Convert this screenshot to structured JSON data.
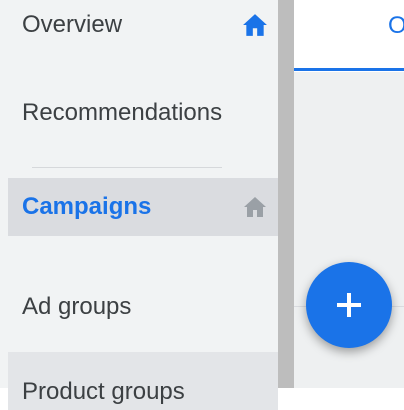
{
  "sidebar": {
    "items": [
      {
        "label": "Overview",
        "icon": "home-icon",
        "icon_color": "#1a73e8"
      },
      {
        "label": "Recommendations"
      },
      {
        "label": "Campaigns",
        "icon": "home-icon",
        "icon_color": "#9aa0a6",
        "active": true
      },
      {
        "label": "Ad groups"
      },
      {
        "label": "Product groups"
      }
    ]
  },
  "main": {
    "tab_partial": "O"
  },
  "fab": {
    "icon": "plus-icon",
    "color": "#1a73e8"
  }
}
